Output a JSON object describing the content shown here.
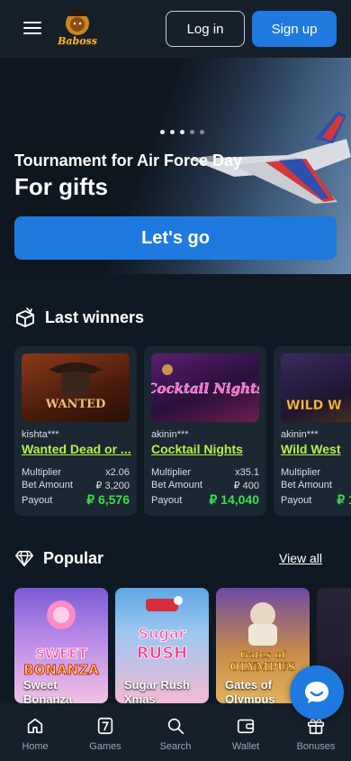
{
  "header": {
    "logo_text": "Baboss",
    "login_label": "Log in",
    "signup_label": "Sign up"
  },
  "hero": {
    "subtitle": "Tournament for Air Force Day",
    "title": "For gifts",
    "cta_label": "Let's go",
    "slide_count": 5,
    "active_slide": 1
  },
  "winners": {
    "title": "Last winners",
    "multiplier_label": "Multiplier",
    "bet_label": "Bet Amount",
    "payout_label": "Payout",
    "items": [
      {
        "user": "kishta***",
        "game": "Wanted Dead or ...",
        "multiplier": "x2.06",
        "bet": "₽ 3,200",
        "payout": "₽ 6,576",
        "thumb_text": "WANTED"
      },
      {
        "user": "akinin***",
        "game": "Cocktail Nights",
        "multiplier": "x35.1",
        "bet": "₽ 400",
        "payout": "₽ 14,040",
        "thumb_text": "Cocktail Nights"
      },
      {
        "user": "akinin***",
        "game": "Wild West",
        "multiplier": "",
        "bet": "",
        "payout": "₽ 1",
        "thumb_text": "WILD W"
      }
    ]
  },
  "popular": {
    "title": "Popular",
    "view_all": "View all",
    "items": [
      {
        "name_line1": "Sweet",
        "name_line2": "Bonanza",
        "art_line1": "SWEET",
        "art_line2": "BONANZA"
      },
      {
        "name_line1": "Sugar Rush",
        "name_line2": "Xmas",
        "art_line1": "Sugar",
        "art_line2": "RUSH"
      },
      {
        "name_line1": "Gates of",
        "name_line2": "Olympus",
        "art_line1": "Gates of",
        "art_line2": "OLYMPUS"
      }
    ]
  },
  "bottom_nav": [
    {
      "label": "Home",
      "icon": "home-icon"
    },
    {
      "label": "Games",
      "icon": "slot-seven-icon"
    },
    {
      "label": "Search",
      "icon": "search-icon"
    },
    {
      "label": "Wallet",
      "icon": "wallet-icon"
    },
    {
      "label": "Bonuses",
      "icon": "gift-icon"
    }
  ],
  "colors": {
    "background": "#0f1923",
    "header": "#16202b",
    "accent": "#1f7ae0",
    "game_link": "#b6f04a",
    "payout": "#3ddc4d"
  }
}
